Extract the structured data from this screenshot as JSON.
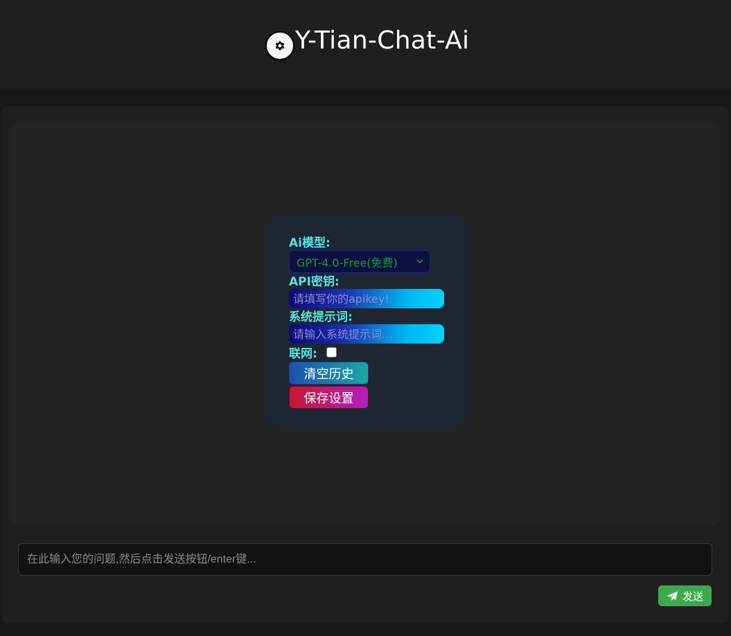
{
  "header": {
    "title": "Y-Tian-Chat-Ai",
    "settings_icon": "gear-icon"
  },
  "settings": {
    "model_label": "Ai模型:",
    "model_value": "GPT-4.0-Free(免费)",
    "apikey_label": "API密钥:",
    "apikey_placeholder": "请填写你的apikey!",
    "prompt_label": "系统提示词:",
    "prompt_placeholder": "请输入系统提示词...",
    "network_label": "联网:",
    "network_checked": false,
    "clear_label": "清空历史",
    "save_label": "保存设置"
  },
  "composer": {
    "placeholder": "在此输入您的问题,然后点击发送按钮/enter键...",
    "send_label": "发送",
    "send_icon": "paper-plane-icon"
  },
  "colors": {
    "label_accent": "#5ce1e6",
    "send_green": "#3caa4a",
    "model_text_green": "#1c9b3e"
  }
}
